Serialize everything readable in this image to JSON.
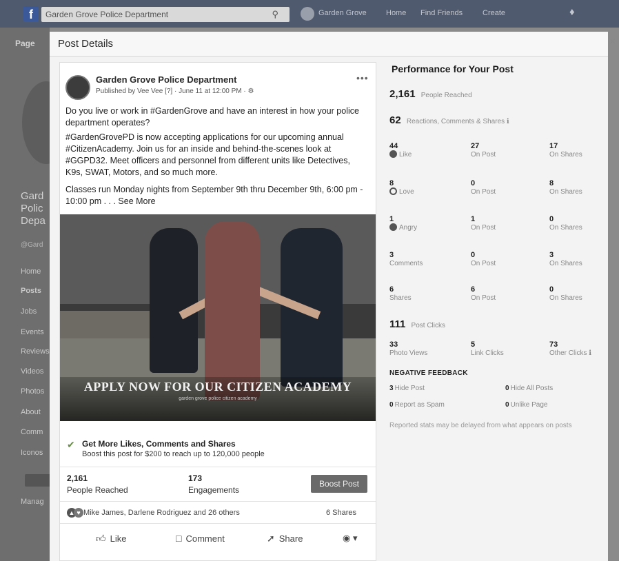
{
  "topbar": {
    "logo": "f",
    "search_value": "Garden Grove Police Department",
    "nav": [
      "Garden Grove",
      "Home",
      "Find Friends",
      "Create"
    ]
  },
  "left_page": {
    "tab": "Page",
    "name_lines": [
      "Gard",
      "Polic",
      "Depa"
    ],
    "handle": "@Gard",
    "nav": [
      "Home",
      "Posts",
      "Jobs",
      "Events",
      "Reviews",
      "Videos",
      "Photos",
      "About",
      "Comm",
      "Iconos"
    ],
    "manage": "Manag"
  },
  "modal": {
    "title": "Post Details",
    "close": "×"
  },
  "post": {
    "page_name": "Garden Grove Police Department",
    "published": "Published by Vee Vee [?] · June 11 at 12:00 PM · ⚙",
    "more": "•••",
    "paragraphs": [
      "Do you live or work in #GardenGrove and have an interest in how your police department operates?",
      "#GardenGrovePD is now accepting applications for our upcoming annual #CitizenAcademy. Join us for an inside and behind-the-scenes look at #GGPD32. Meet officers and personnel from different units like Detectives, K9s, SWAT, Motors, and so much more.",
      "Classes run Monday nights from September 9th thru December 9th, 6:00 pm - 10:00 pm . . . See More"
    ],
    "image_banner": "APPLY NOW FOR OUR CITIZEN ACADEMY",
    "image_sub": "garden grove police citizen academy",
    "boost_title": "Get More Likes, Comments and Shares",
    "boost_sub": "Boost this post for $200 to reach up to 120,000 people",
    "people_reached_num": "2,161",
    "people_reached_lbl": "People Reached",
    "engagements_num": "173",
    "engagements_lbl": "Engagements",
    "boost_button": "Boost Post",
    "reaction_names": "Mike James, Darlene Rodriguez and 26 others",
    "shares": "6 Shares",
    "actions": {
      "like": "Like",
      "comment": "Comment",
      "share": "Share"
    }
  },
  "performance": {
    "title": "Performance for Your Post",
    "people_reached": {
      "num": "2,161",
      "label": "People Reached"
    },
    "reactions_total": {
      "num": "62",
      "label": "Reactions, Comments & Shares ℹ"
    },
    "rows": [
      [
        {
          "num": "44",
          "label": "Like"
        },
        {
          "num": "27",
          "label": "On Post"
        },
        {
          "num": "17",
          "label": "On Shares"
        }
      ],
      [
        {
          "num": "8",
          "label": "Love"
        },
        {
          "num": "0",
          "label": "On Post"
        },
        {
          "num": "8",
          "label": "On Shares"
        }
      ],
      [
        {
          "num": "1",
          "label": "Angry"
        },
        {
          "num": "1",
          "label": "On Post"
        },
        {
          "num": "0",
          "label": "On Shares"
        }
      ],
      [
        {
          "num": "3",
          "label": "Comments"
        },
        {
          "num": "0",
          "label": "On Post"
        },
        {
          "num": "3",
          "label": "On Shares"
        }
      ],
      [
        {
          "num": "6",
          "label": "Shares"
        },
        {
          "num": "6",
          "label": "On Post"
        },
        {
          "num": "0",
          "label": "On Shares"
        }
      ]
    ],
    "post_clicks": {
      "num": "111",
      "label": "Post Clicks"
    },
    "clicks_row": [
      {
        "num": "33",
        "label": "Photo Views"
      },
      {
        "num": "5",
        "label": "Link Clicks"
      },
      {
        "num": "73",
        "label": "Other Clicks ℹ"
      }
    ],
    "negative_title": "NEGATIVE FEEDBACK",
    "negative": [
      {
        "num": "3",
        "label": "Hide Post"
      },
      {
        "num": "0",
        "label": "Hide All Posts"
      },
      {
        "num": "0",
        "label": "Report as Spam"
      },
      {
        "num": "0",
        "label": "Unlike Page"
      }
    ],
    "note": "Reported stats may be delayed from what appears on posts"
  }
}
